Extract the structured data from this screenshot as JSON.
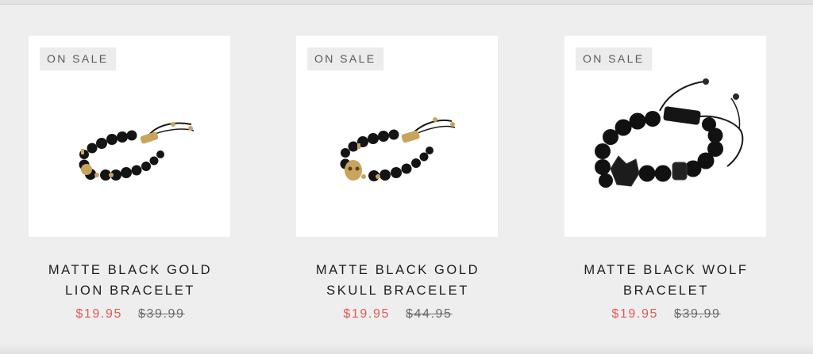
{
  "products": [
    {
      "badge": "ON SALE",
      "title_line1": "MATTE BLACK GOLD",
      "title_line2": "LION BRACELET",
      "price_sale": "$19.95",
      "price_original": "$39.99"
    },
    {
      "badge": "ON SALE",
      "title_line1": "MATTE BLACK GOLD",
      "title_line2": "SKULL BRACELET",
      "price_sale": "$19.95",
      "price_original": "$44.95"
    },
    {
      "badge": "ON SALE",
      "title_line1": "MATTE BLACK WOLF",
      "title_line2": "BRACELET",
      "price_sale": "$19.95",
      "price_original": "$39.99"
    }
  ],
  "colors": {
    "background": "#efeeee",
    "sale_price": "#e05a55",
    "original_price": "#6b6b6b",
    "badge_bg": "#ececec",
    "gold": "#c9a45c",
    "bead": "#141414"
  }
}
